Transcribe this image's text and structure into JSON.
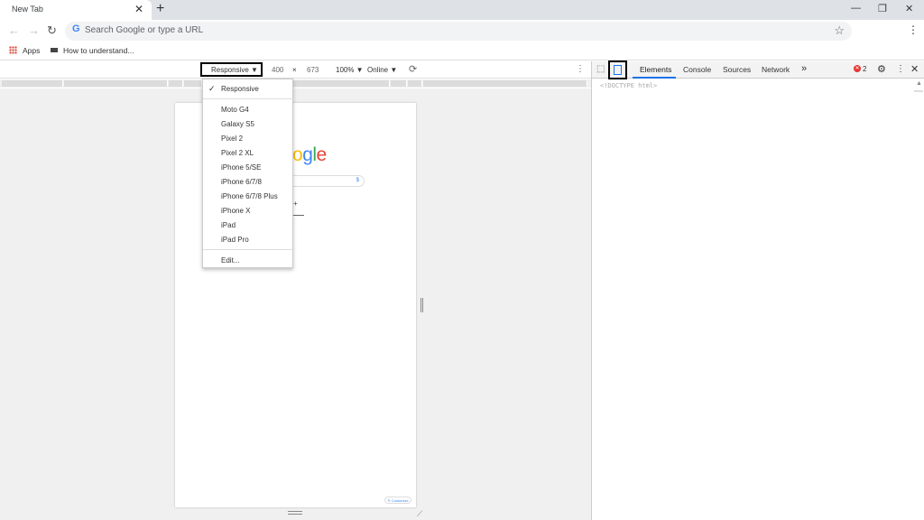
{
  "browser": {
    "tab_title": "New Tab",
    "tab_close": "✕",
    "new_tab": "+",
    "minimize": "—",
    "restore": "❐",
    "close": "✕",
    "back": "←",
    "forward": "→",
    "reload": "↻",
    "omnibox_g": "G",
    "omnibox_placeholder": "Search Google or type a URL",
    "star": "☆",
    "menu": "⋮"
  },
  "bookmarks": {
    "apps": "Apps",
    "item1": "How to understand..."
  },
  "device_toolbar": {
    "mode": "Responsive ▼",
    "width": "400",
    "times": "×",
    "height": "673",
    "zoom": "100% ▼",
    "network": "Online ▼",
    "rotate": "⟳",
    "more": "⋮"
  },
  "device_menu": {
    "check": "✓",
    "items": [
      "Responsive",
      "Moto G4",
      "Galaxy S5",
      "Pixel 2",
      "Pixel 2 XL",
      "iPhone 5/SE",
      "iPhone 6/7/8",
      "iPhone 6/7/8 Plus",
      "iPhone X",
      "iPad",
      "iPad Pro",
      "Edit..."
    ]
  },
  "page": {
    "logo_o1": "o",
    "logo_g": "g",
    "logo_l": "l",
    "logo_e": "e",
    "search_icon": "$",
    "plus": "+",
    "customize": "✎ Customize"
  },
  "handles": {
    "corner": "⟋"
  },
  "devtools": {
    "inspect": "⬚",
    "tabs": [
      "Elements",
      "Console",
      "Sources",
      "Network"
    ],
    "overflow": "»",
    "error_icon": "✕",
    "error_count": "2",
    "gear": "⚙",
    "more": "⋮",
    "close": "✕",
    "doctype": "<!DOCTYPE html>",
    "scroll_up": "▲"
  },
  "colors": {
    "google_blue": "#4285f4",
    "google_red": "#ea4335",
    "google_yellow": "#fbbc05",
    "google_green": "#34a853",
    "devtools_accent": "#1a73e8"
  }
}
